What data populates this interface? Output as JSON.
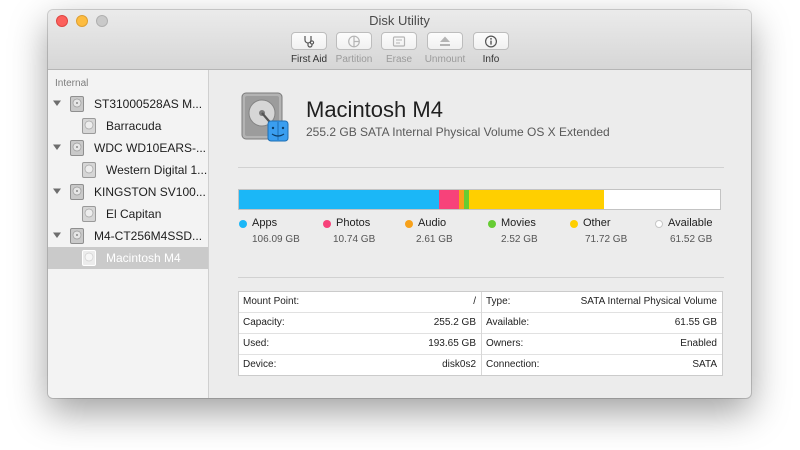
{
  "window": {
    "title": "Disk Utility"
  },
  "toolbar": {
    "items": [
      {
        "label": "First Aid",
        "icon": "stethoscope-icon",
        "enabled": true
      },
      {
        "label": "Partition",
        "icon": "partition-icon",
        "enabled": false
      },
      {
        "label": "Erase",
        "icon": "erase-icon",
        "enabled": false
      },
      {
        "label": "Unmount",
        "icon": "unmount-icon",
        "enabled": false
      },
      {
        "label": "Info",
        "icon": "info-icon",
        "enabled": true
      }
    ]
  },
  "sidebar": {
    "section": "Internal",
    "items": [
      {
        "label": "ST31000528AS M...",
        "kind": "disk"
      },
      {
        "label": "Barracuda",
        "kind": "volume"
      },
      {
        "label": "WDC WD10EARS-...",
        "kind": "disk"
      },
      {
        "label": "Western Digital 1...",
        "kind": "volume"
      },
      {
        "label": "KINGSTON SV100...",
        "kind": "disk"
      },
      {
        "label": "El Capitan",
        "kind": "volume"
      },
      {
        "label": "M4-CT256M4SSD...",
        "kind": "disk"
      },
      {
        "label": "Macintosh M4",
        "kind": "volume",
        "selected": true
      }
    ]
  },
  "volume": {
    "name": "Macintosh M4",
    "description": "255.2 GB SATA Internal Physical Volume OS X Extended"
  },
  "usage": {
    "total_gb": 255.2,
    "categories": [
      {
        "name": "Apps",
        "size": "106.09 GB",
        "gb": 106.09,
        "color": "#1bb7f7"
      },
      {
        "name": "Photos",
        "size": "10.74 GB",
        "gb": 10.74,
        "color": "#f7427a"
      },
      {
        "name": "Audio",
        "size": "2.61 GB",
        "gb": 2.61,
        "color": "#f7a11a"
      },
      {
        "name": "Movies",
        "size": "2.52 GB",
        "gb": 2.52,
        "color": "#66cc33"
      },
      {
        "name": "Other",
        "size": "71.72 GB",
        "gb": 71.72,
        "color": "#ffcf00"
      },
      {
        "name": "Available",
        "size": "61.52 GB",
        "gb": 61.52,
        "color": "#ffffff"
      }
    ]
  },
  "info": {
    "left": [
      {
        "key": "Mount Point:",
        "value": "/"
      },
      {
        "key": "Capacity:",
        "value": "255.2 GB"
      },
      {
        "key": "Used:",
        "value": "193.65 GB"
      },
      {
        "key": "Device:",
        "value": "disk0s2"
      }
    ],
    "right": [
      {
        "key": "Type:",
        "value": "SATA Internal Physical Volume"
      },
      {
        "key": "Available:",
        "value": "61.55 GB"
      },
      {
        "key": "Owners:",
        "value": "Enabled"
      },
      {
        "key": "Connection:",
        "value": "SATA"
      }
    ]
  }
}
